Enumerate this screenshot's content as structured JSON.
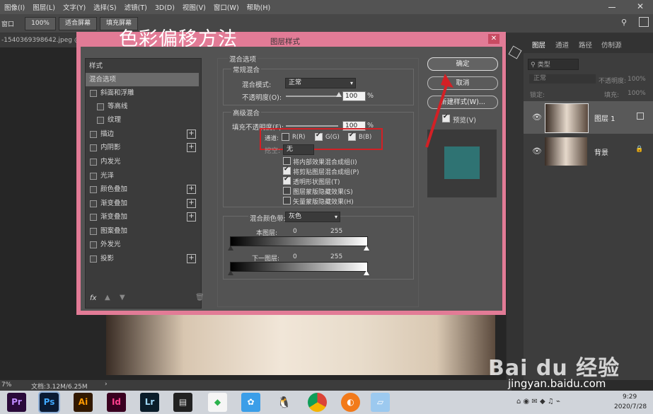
{
  "menubar": {
    "items": [
      "图像(I)",
      "图层(L)",
      "文字(Y)",
      "选择(S)",
      "滤镜(T)",
      "3D(D)",
      "视图(V)",
      "窗口(W)",
      "帮助(H)"
    ]
  },
  "options": {
    "window_label": "窗口",
    "zoom": "100%",
    "fit_screen": "适合屏幕",
    "fill_screen": "填充屏幕"
  },
  "doc_tab": "-1540369398642.jpeg @",
  "status": {
    "zoom": "7%",
    "doc_info": "文档:3.12M/6.25M"
  },
  "overlay_title": "色彩偏移方法",
  "dialog": {
    "title": "图层样式",
    "styles_header": "样式",
    "styles": [
      {
        "label": "混合选项",
        "checkbox": false,
        "plus": false,
        "selected": true
      },
      {
        "label": "斜面和浮雕",
        "checkbox": true,
        "plus": false
      },
      {
        "label": "等高线",
        "checkbox": true,
        "plus": false,
        "indent": true
      },
      {
        "label": "纹理",
        "checkbox": true,
        "plus": false,
        "indent": true
      },
      {
        "label": "描边",
        "checkbox": true,
        "plus": true
      },
      {
        "label": "内阴影",
        "checkbox": true,
        "plus": true
      },
      {
        "label": "内发光",
        "checkbox": true,
        "plus": false
      },
      {
        "label": "光泽",
        "checkbox": true,
        "plus": false
      },
      {
        "label": "颜色叠加",
        "checkbox": true,
        "plus": true
      },
      {
        "label": "渐变叠加",
        "checkbox": true,
        "plus": true
      },
      {
        "label": "渐变叠加",
        "checkbox": true,
        "plus": true
      },
      {
        "label": "图案叠加",
        "checkbox": true,
        "plus": false
      },
      {
        "label": "外发光",
        "checkbox": true,
        "plus": false
      },
      {
        "label": "投影",
        "checkbox": true,
        "plus": true
      }
    ],
    "fx_label": "fx",
    "blend_options_title": "混合选项",
    "general_blend": "常规混合",
    "blend_mode_label": "混合模式:",
    "blend_mode_value": "正常",
    "opacity_label": "不透明度(O):",
    "opacity_value": "100",
    "percent": "%",
    "advanced_blend": "高级混合",
    "fill_opacity_label": "填充不透明度(F):",
    "fill_opacity_value": "100",
    "channels_label": "通道:",
    "channels": [
      {
        "label": "R(R)",
        "checked": false
      },
      {
        "label": "G(G)",
        "checked": true
      },
      {
        "label": "B(B)",
        "checked": true
      }
    ],
    "knockout_label": "挖空:",
    "knockout_value": "无",
    "options": [
      {
        "label": "将内部效果混合成组(I)",
        "checked": false
      },
      {
        "label": "将剪贴图层混合成组(P)",
        "checked": true
      },
      {
        "label": "透明形状图层(T)",
        "checked": true
      },
      {
        "label": "图层蒙版隐藏效果(S)",
        "checked": false
      },
      {
        "label": "矢量蒙版隐藏效果(H)",
        "checked": false
      }
    ],
    "blend_if_label": "混合颜色带:",
    "blend_if_value": "灰色",
    "this_layer_label": "本图层:",
    "underlying_label": "下一图层:",
    "range_min": "0",
    "range_max": "255",
    "ok_label": "确定",
    "cancel_label": "取消",
    "new_style_label": "新建样式(W)...",
    "preview_label": "预览(V)",
    "preview_checked": true,
    "preview_color": "#2f7373"
  },
  "layers_panel": {
    "tabs": [
      "图层",
      "通道",
      "路径",
      "仿制源"
    ],
    "filter_placeholder": "类型",
    "blend_mode": "正常",
    "opacity_label": "不透明度:",
    "opacity_value": "100%",
    "lock_label": "锁定:",
    "fill_label": "填充:",
    "fill_value": "100%",
    "layers": [
      {
        "name": "图层 1"
      },
      {
        "name": "背景"
      }
    ]
  },
  "taskbar": {
    "apps": [
      "Pr",
      "Ps",
      "Ai",
      "Id",
      "Lr"
    ],
    "time": "9:29",
    "date": "2020/7/28"
  },
  "watermark": {
    "brand": "Bai du 经验",
    "url": "jingyan.baidu.com"
  },
  "colors": {
    "dialog_border": "#e27b96",
    "highlight_box": "#d32025",
    "arrow": "#d32025"
  }
}
